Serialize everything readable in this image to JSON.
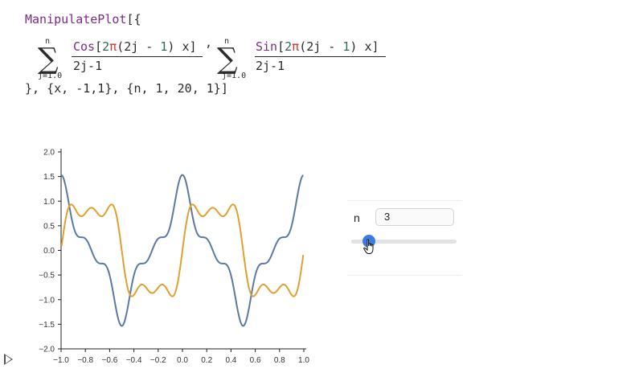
{
  "code": {
    "line1_fn": "ManipulatePlot",
    "line1_rest": "[{",
    "sum1_upper": "n",
    "sum1_lower": "j=1.0",
    "sum1_num_fn": "Cos",
    "sum1_num_open": "[",
    "two": "2",
    "pi": "π",
    "num_mid": "(2j - ",
    "one": "1",
    "num_end": ") x]",
    "denom": "2j-1",
    "comma": ",",
    "sum2_upper": "n",
    "sum2_lower": "j=1.0",
    "sum2_num_fn": "Sin",
    "sum2_num_open": "[",
    "line3": "}, {x, -1,1}, {n, 1, 20, 1}]"
  },
  "control": {
    "label": "n",
    "value": "3",
    "slider_min": 1,
    "slider_max": 20,
    "slider_value": 3
  },
  "chart_data": {
    "type": "line",
    "xlim": [
      -1.0,
      1.0
    ],
    "ylim": [
      -2.0,
      2.0
    ],
    "x_ticks": [
      "−1.0",
      "−0.8",
      "−0.6",
      "−0.4",
      "−0.2",
      "0.0",
      "0.2",
      "0.4",
      "0.6",
      "0.8",
      "1.0"
    ],
    "y_ticks": [
      "−2.0",
      "−1.5",
      "−1.0",
      "−0.5",
      "0.0",
      "0.5",
      "1.0",
      "1.5",
      "2.0"
    ],
    "n": 3,
    "series": [
      {
        "expr": "Sum[Cos[2π(2j-1)x]/(2j-1), {j,1,n}]",
        "color": "#5a7aa3"
      },
      {
        "expr": "Sum[Sin[2π(2j-1)x]/(2j-1), {j,1,n}]",
        "color": "#e0a030"
      }
    ]
  }
}
